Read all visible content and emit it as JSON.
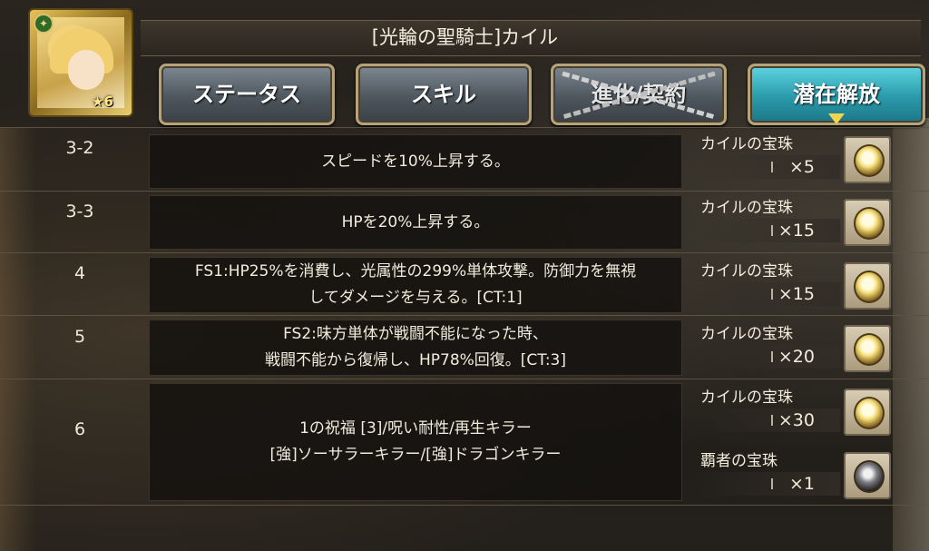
{
  "header": {
    "title": "[光輪の聖騎士]カイル"
  },
  "character": {
    "rank": "6",
    "icon": "character-portrait"
  },
  "tabs": [
    {
      "label": "ステータス",
      "state": "normal"
    },
    {
      "label": "スキル",
      "state": "normal"
    },
    {
      "label": "進化/契約",
      "state": "locked"
    },
    {
      "label": "潜在解放",
      "state": "active"
    }
  ],
  "rows": [
    {
      "level": "3-2",
      "description_lines": [
        "スピードを10%上昇する。"
      ],
      "materials": [
        {
          "name": "カイルの宝珠",
          "qty": "×5"
        }
      ]
    },
    {
      "level": "3-3",
      "description_lines": [
        "HPを20%上昇する。"
      ],
      "materials": [
        {
          "name": "カイルの宝珠",
          "qty": "×15"
        }
      ]
    },
    {
      "level": "4",
      "description_lines": [
        "FS1:HP25%を消費し、光属性の299%単体攻撃。防御力を無視",
        "してダメージを与える。[CT:1]"
      ],
      "materials": [
        {
          "name": "カイルの宝珠",
          "qty": "×15"
        }
      ]
    },
    {
      "level": "5",
      "description_lines": [
        "FS2:味方単体が戦闘不能になった時、",
        "戦闘不能から復帰し、HP78%回復。[CT:3]"
      ],
      "materials": [
        {
          "name": "カイルの宝珠",
          "qty": "×20"
        }
      ]
    },
    {
      "level": "6",
      "description_lines": [
        "1の祝福 [3]/呪い耐性/再生キラー",
        "[強]ソーサラーキラー/[強]ドラゴンキラー"
      ],
      "materials": [
        {
          "name": "カイルの宝珠",
          "qty": "×30"
        },
        {
          "name": "覇者の宝珠",
          "qty": "×1"
        }
      ]
    }
  ],
  "colors": {
    "active_tab": "#2a9aab",
    "gold": "#f0d650"
  }
}
